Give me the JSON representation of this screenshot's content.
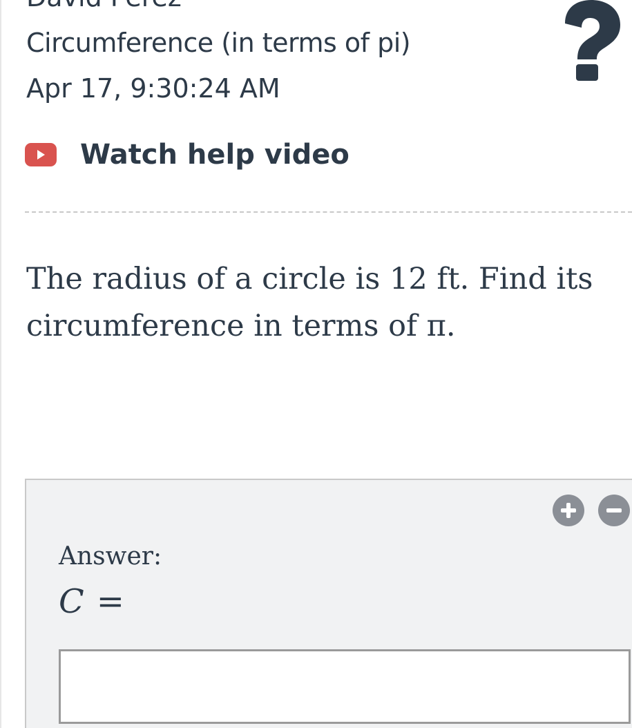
{
  "header": {
    "student_name": "David Perez",
    "assignment_title": "Circumference (in terms of pi)",
    "timestamp": "Apr 17, 9:30:24 AM",
    "help_icon": "question-mark-icon"
  },
  "help_video": {
    "label": "Watch help video",
    "icon": "play-video-icon",
    "icon_color": "#d9534f"
  },
  "question": {
    "text": "The radius of a circle is 12 ft. Find its circumference in terms of π."
  },
  "answer": {
    "label": "Answer:",
    "variable": "C",
    "equals": "=",
    "input_value": "",
    "add_button_icon": "plus-circle-icon",
    "remove_button_icon": "minus-circle-icon"
  },
  "colors": {
    "text": "#2d3a48",
    "panel_background": "#f1f2f3",
    "button_gray": "#8b8f96"
  }
}
